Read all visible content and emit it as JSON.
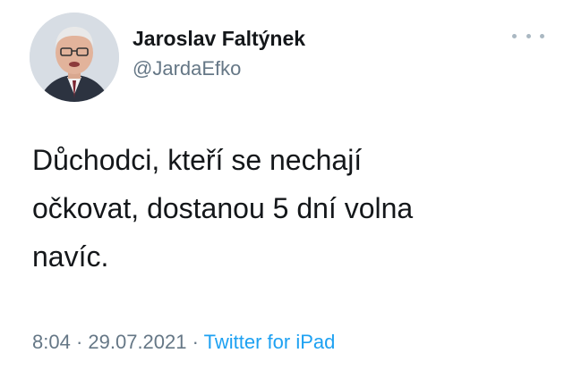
{
  "author": {
    "display_name": "Jaroslav Faltýnek",
    "handle": "@JardaEfko"
  },
  "menu": {
    "icon": "more-horizontal-icon"
  },
  "tweet": {
    "text": "Důchodci, kteří se nechají\nočkovat, dostanou 5 dní volna\nnavíc."
  },
  "meta": {
    "time": "8:04",
    "separator1": " · ",
    "date": "29.07.2021",
    "separator2": " · ",
    "source": "Twitter for iPad"
  },
  "colors": {
    "text": "#14171a",
    "secondary": "#657786",
    "link": "#1da1f2"
  }
}
